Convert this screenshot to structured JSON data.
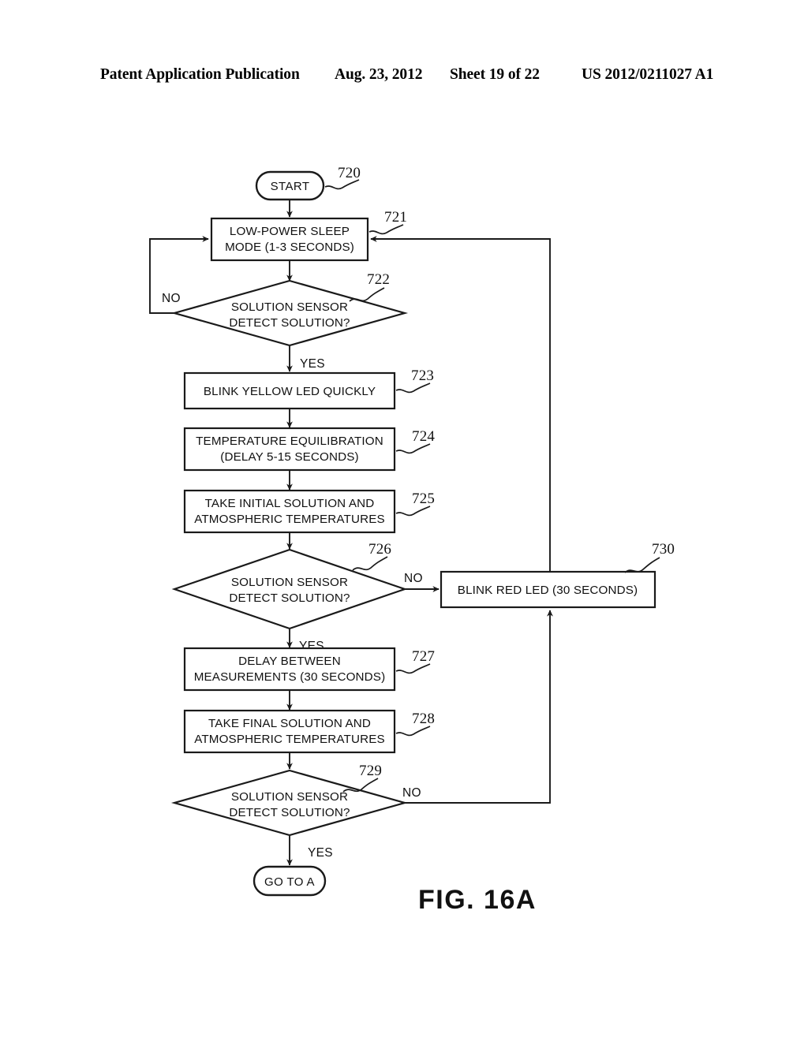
{
  "header": {
    "publication": "Patent Application Publication",
    "date": "Aug. 23, 2012",
    "sheet": "Sheet 19 of 22",
    "publication_number": "US 2012/0211027 A1"
  },
  "figure": {
    "caption": "FIG. 16A"
  },
  "chart_data": {
    "type": "diagram",
    "title": "FIG. 16A",
    "diagram_kind": "flowchart",
    "nodes": [
      {
        "id": "720",
        "ref": "720",
        "shape": "terminal",
        "label": "START"
      },
      {
        "id": "721",
        "ref": "721",
        "shape": "process",
        "label": "LOW-POWER SLEEP MODE (1-3 SECONDS)",
        "lines": [
          "LOW-POWER SLEEP",
          "MODE (1-3 SECONDS)"
        ]
      },
      {
        "id": "722",
        "ref": "722",
        "shape": "decision",
        "label": "SOLUTION SENSOR DETECT SOLUTION?",
        "lines": [
          "SOLUTION SENSOR",
          "DETECT SOLUTION?"
        ]
      },
      {
        "id": "723",
        "ref": "723",
        "shape": "process",
        "label": "BLINK YELLOW LED QUICKLY",
        "lines": [
          "BLINK YELLOW LED QUICKLY"
        ]
      },
      {
        "id": "724",
        "ref": "724",
        "shape": "process",
        "label": "TEMPERATURE EQUILIBRATION (DELAY 5-15 SECONDS)",
        "lines": [
          "TEMPERATURE EQUILIBRATION",
          "(DELAY 5-15 SECONDS)"
        ]
      },
      {
        "id": "725",
        "ref": "725",
        "shape": "process",
        "label": "TAKE INITIAL SOLUTION AND ATMOSPHERIC TEMPERATURES",
        "lines": [
          "TAKE INITIAL SOLUTION AND",
          "ATMOSPHERIC TEMPERATURES"
        ]
      },
      {
        "id": "726",
        "ref": "726",
        "shape": "decision",
        "label": "SOLUTION SENSOR DETECT SOLUTION?",
        "lines": [
          "SOLUTION SENSOR",
          "DETECT SOLUTION?"
        ]
      },
      {
        "id": "727",
        "ref": "727",
        "shape": "process",
        "label": "DELAY BETWEEN MEASUREMENTS (30 SECONDS)",
        "lines": [
          "DELAY BETWEEN",
          "MEASUREMENTS (30 SECONDS)"
        ]
      },
      {
        "id": "728",
        "ref": "728",
        "shape": "process",
        "label": "TAKE FINAL SOLUTION AND ATMOSPHERIC TEMPERATURES",
        "lines": [
          "TAKE FINAL SOLUTION AND",
          "ATMOSPHERIC TEMPERATURES"
        ]
      },
      {
        "id": "729",
        "ref": "729",
        "shape": "decision",
        "label": "SOLUTION SENSOR DETECT SOLUTION?",
        "lines": [
          "SOLUTION SENSOR",
          "DETECT SOLUTION?"
        ]
      },
      {
        "id": "730",
        "ref": "730",
        "shape": "process",
        "label": "BLINK RED LED (30 SECONDS)",
        "lines": [
          "BLINK RED LED (30 SECONDS)"
        ]
      },
      {
        "id": "goto_a",
        "ref": "",
        "shape": "terminal",
        "label": "GO TO A"
      }
    ],
    "edges": [
      {
        "from": "720",
        "to": "721",
        "label": ""
      },
      {
        "from": "721",
        "to": "722",
        "label": ""
      },
      {
        "from": "722",
        "to": "721",
        "label": "NO"
      },
      {
        "from": "722",
        "to": "723",
        "label": "YES"
      },
      {
        "from": "723",
        "to": "724",
        "label": ""
      },
      {
        "from": "724",
        "to": "725",
        "label": ""
      },
      {
        "from": "725",
        "to": "726",
        "label": ""
      },
      {
        "from": "726",
        "to": "730",
        "label": "NO"
      },
      {
        "from": "726",
        "to": "727",
        "label": "YES"
      },
      {
        "from": "727",
        "to": "728",
        "label": ""
      },
      {
        "from": "728",
        "to": "729",
        "label": ""
      },
      {
        "from": "729",
        "to": "730",
        "label": "NO"
      },
      {
        "from": "729",
        "to": "goto_a",
        "label": "YES"
      },
      {
        "from": "730",
        "to": "721",
        "label": ""
      }
    ],
    "branch_labels": {
      "no_722": "NO",
      "yes_722": "YES",
      "no_726": "NO",
      "yes_726": "YES",
      "no_729": "NO",
      "yes_729": "YES"
    }
  }
}
